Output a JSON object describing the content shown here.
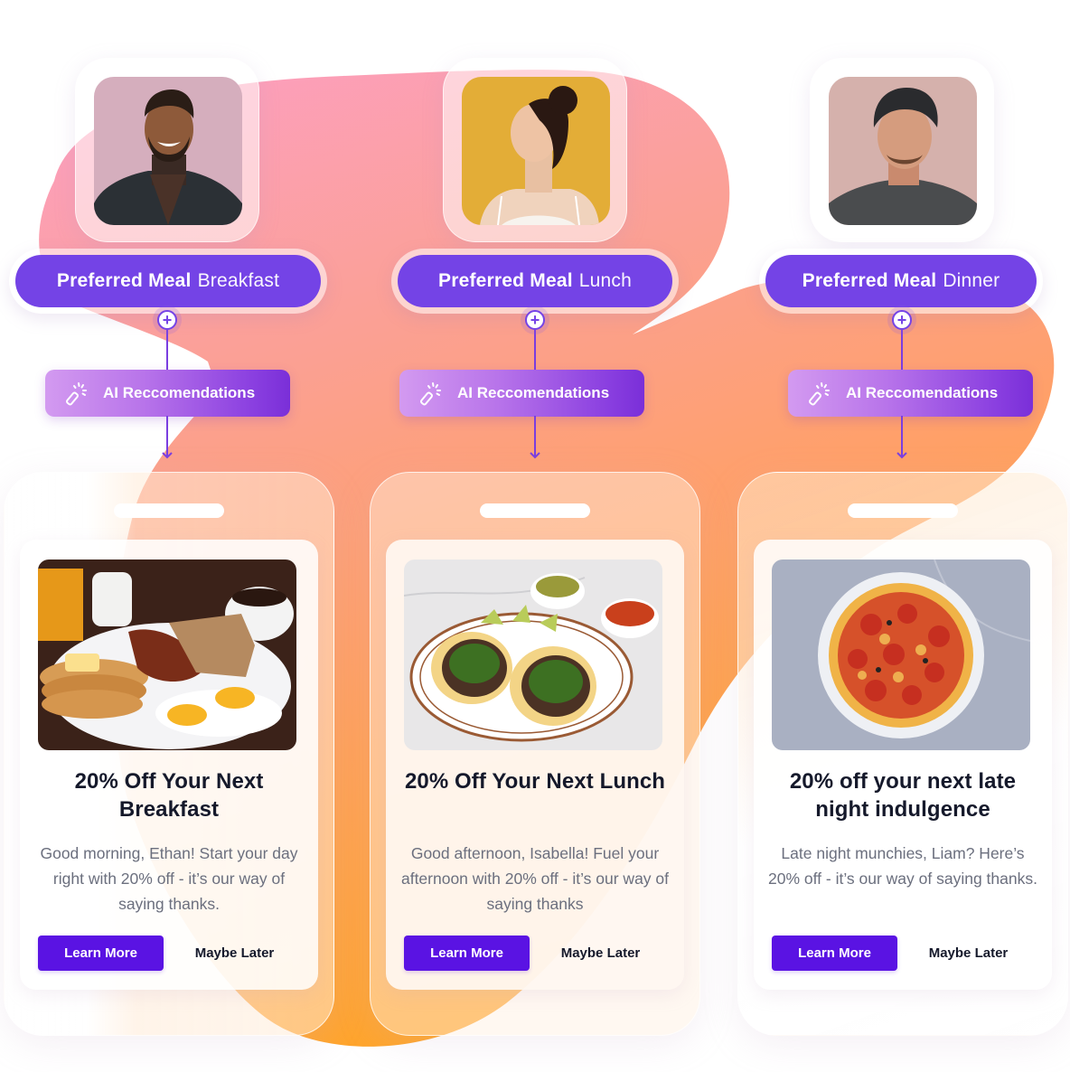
{
  "colors": {
    "brand_purple": "#7443e6",
    "button_purple": "#5a13e3",
    "ai_gradient_start": "#d39af0",
    "ai_gradient_end": "#7a2fd8",
    "blob_pink": "#fca2c0",
    "blob_orange": "#ffa030",
    "title_text": "#15192b",
    "body_text": "#6b6f7e"
  },
  "flows": [
    {
      "person": "Ethan",
      "avatar_icon": "person-photo-man-turtleneck",
      "preferred_meal_label": "Preferred Meal",
      "preferred_meal_value": "Breakfast",
      "ai_label": "AI Reccomendations",
      "food_image": "breakfast-plate-photo",
      "card_title": "20% Off Your Next Breakfast",
      "card_body": "Good morning, Ethan! Start your day right with 20% off - it’s our way of saying thanks.",
      "primary_button": "Learn More",
      "secondary_button": "Maybe Later"
    },
    {
      "person": "Isabella",
      "avatar_icon": "person-photo-woman-yellow-bg",
      "preferred_meal_label": "Preferred Meal",
      "preferred_meal_value": "Lunch",
      "ai_label": "AI Reccomendations",
      "food_image": "tacos-plate-photo",
      "card_title": "20% Off Your Next Lunch",
      "card_body": "Good afternoon, Isabella! Fuel your afternoon with 20% off - it’s our way of saying thanks",
      "primary_button": "Learn More",
      "secondary_button": "Maybe Later"
    },
    {
      "person": "Liam",
      "avatar_icon": "person-photo-man-cap",
      "preferred_meal_label": "Preferred Meal",
      "preferred_meal_value": "Dinner",
      "ai_label": "AI Reccomendations",
      "food_image": "pizza-photo",
      "card_title": "20% off your next late night indulgence",
      "card_body": "Late night munchies, Liam? Here’s 20% off - it’s our way of saying thanks.",
      "primary_button": "Learn More",
      "secondary_button": "Maybe Later"
    }
  ]
}
